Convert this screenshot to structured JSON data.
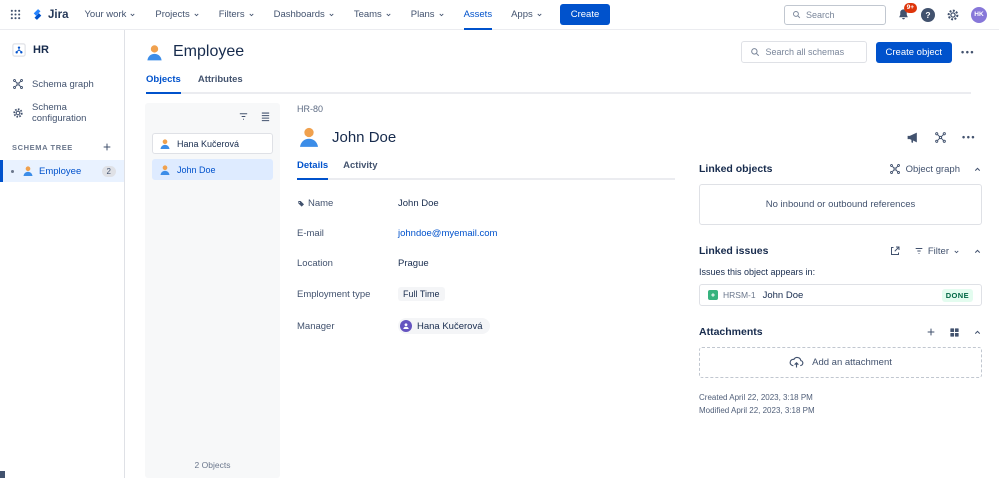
{
  "topnav": {
    "logo_text": "Jira",
    "items": [
      {
        "label": "Your work"
      },
      {
        "label": "Projects"
      },
      {
        "label": "Filters"
      },
      {
        "label": "Dashboards"
      },
      {
        "label": "Teams"
      },
      {
        "label": "Plans"
      },
      {
        "label": "Assets"
      },
      {
        "label": "Apps"
      }
    ],
    "active_item": "Assets",
    "create_label": "Create",
    "search_placeholder": "Search",
    "notifications_badge": "9+",
    "avatar_initials": "HK"
  },
  "icons": {
    "help_glyph": "?",
    "more_glyph": "•••"
  },
  "sidebar": {
    "schema_name": "HR",
    "items": [
      {
        "label": "Schema graph"
      },
      {
        "label": "Schema configuration"
      }
    ],
    "tree_header": "SCHEMA TREE",
    "tree_items": [
      {
        "label": "Employee",
        "count": "2",
        "selected": true
      }
    ]
  },
  "header": {
    "title": "Employee",
    "tabs": [
      {
        "label": "Objects",
        "active": true
      },
      {
        "label": "Attributes",
        "active": false
      }
    ],
    "search_placeholder": "Search all schemas",
    "create_object_label": "Create object"
  },
  "object_list": {
    "items": [
      {
        "label": "Hana Kučerová",
        "selected": false
      },
      {
        "label": "John Doe",
        "selected": true
      }
    ],
    "footer": "2 Objects"
  },
  "object_view": {
    "breadcrumb": "HR-80",
    "title": "John Doe",
    "tabs": [
      {
        "label": "Details",
        "active": true
      },
      {
        "label": "Activity",
        "active": false
      }
    ],
    "fields": [
      {
        "label": "Name",
        "value": "John Doe",
        "type": "text"
      },
      {
        "label": "E-mail",
        "value": "johndoe@myemail.com",
        "type": "link"
      },
      {
        "label": "Location",
        "value": "Prague",
        "type": "text"
      },
      {
        "label": "Employment type",
        "value": "Full Time",
        "type": "lozenge"
      },
      {
        "label": "Manager",
        "value": "Hana Kučerová",
        "type": "user"
      }
    ]
  },
  "linked_objects": {
    "title": "Linked objects",
    "object_graph_label": "Object graph",
    "empty_message": "No inbound or outbound references"
  },
  "linked_issues": {
    "title": "Linked issues",
    "filter_label": "Filter",
    "subtitle": "Issues this object appears in:",
    "issues": [
      {
        "key": "HRSM-1",
        "summary": "John Doe",
        "status": "DONE"
      }
    ]
  },
  "attachments": {
    "title": "Attachments",
    "add_label": "Add an attachment"
  },
  "meta": {
    "created": "Created April 22, 2023, 3:18 PM",
    "modified": "Modified April 22, 2023, 3:18 PM"
  },
  "colors": {
    "accent": "#0052CC",
    "selected_bg": "#DEEBFF",
    "sidebar_selected_bg": "#E9F2FF",
    "done_bg": "#E3FCEF",
    "done_text": "#006644",
    "badge_red": "#DE350B",
    "issue_type_green": "#36B37E",
    "avatar_purple": "#8777D9"
  }
}
